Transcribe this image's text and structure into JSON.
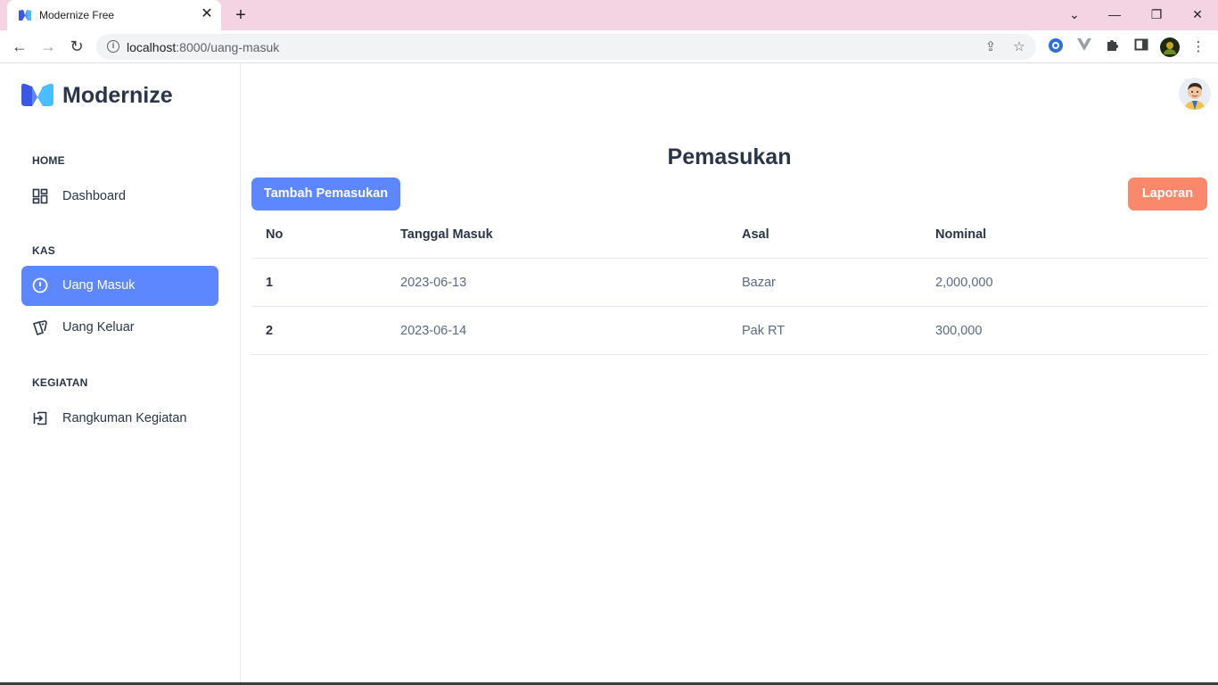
{
  "browser": {
    "tab_title": "Modernize Free",
    "url_host": "localhost",
    "url_path": ":8000/uang-masuk",
    "colors": {
      "tabbar": "#f4d3e2"
    }
  },
  "sidebar": {
    "brand": "Modernize",
    "sections": [
      {
        "caption": "HOME",
        "items": [
          {
            "label": "Dashboard",
            "icon": "layout-dashboard-icon",
            "active": false
          }
        ]
      },
      {
        "caption": "KAS",
        "items": [
          {
            "label": "Uang Masuk",
            "icon": "alert-circle-icon",
            "active": true
          },
          {
            "label": "Uang Keluar",
            "icon": "cards-icon",
            "active": false
          }
        ]
      },
      {
        "caption": "KEGIATAN",
        "items": [
          {
            "label": "Rangkuman Kegiatan",
            "icon": "login-icon",
            "active": false
          }
        ]
      }
    ]
  },
  "main": {
    "title": "Pemasukan",
    "add_button": "Tambah Pemasukan",
    "report_button": "Laporan",
    "table": {
      "columns": [
        "No",
        "Tanggal Masuk",
        "Asal",
        "Nominal"
      ],
      "rows": [
        [
          "1",
          "2023-06-13",
          "Bazar",
          "2,000,000"
        ],
        [
          "2",
          "2023-06-14",
          "Pak RT",
          "300,000"
        ]
      ]
    }
  },
  "colors": {
    "primary": "#5d87ff",
    "secondary": "#fa896b",
    "text": "#2a3547",
    "muted": "#5a6a85"
  }
}
